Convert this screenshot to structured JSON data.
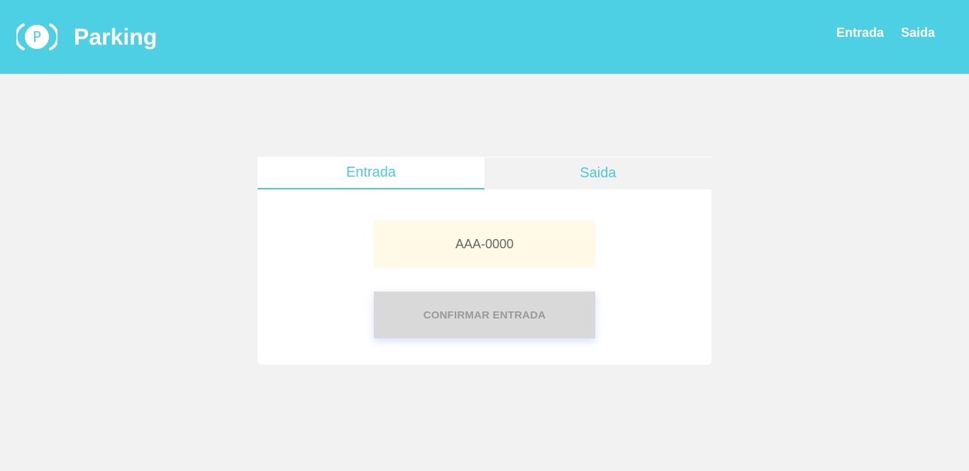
{
  "header": {
    "brand": "Parking",
    "logo_icon": "parking-p-icon",
    "logo_letter": "P",
    "nav": [
      {
        "label": "Entrada"
      },
      {
        "label": "Saida"
      }
    ]
  },
  "tabs": [
    {
      "label": "Entrada",
      "active": true
    },
    {
      "label": "Saida",
      "active": false
    }
  ],
  "form": {
    "plate_placeholder": "AAA-0000",
    "plate_value": "",
    "confirm_label": "CONFIRMAR ENTRADA"
  },
  "colors": {
    "header": "#4dd0e4",
    "accent": "#4dc8dc",
    "background": "#f2f2f2",
    "input_bg": "#fff9e6",
    "button_bg": "#d9d9d9"
  }
}
